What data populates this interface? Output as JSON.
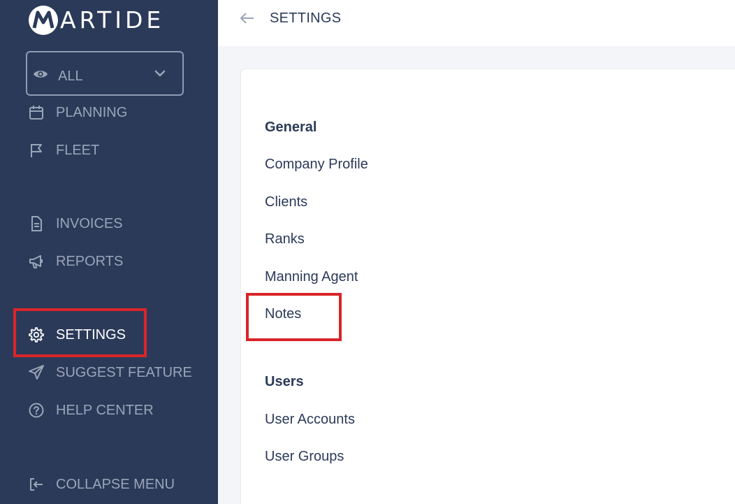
{
  "brand": {
    "name": "ARTIDE",
    "logo_letter": "M",
    "colors": {
      "sidebar_bg": "#2b3a59",
      "highlight": "#d9252a",
      "text_dark": "#2b3a59",
      "text_muted": "#9aa5b8"
    }
  },
  "view_select": {
    "selected": "ALL",
    "icon": "eye-icon"
  },
  "sidebar": {
    "items": [
      {
        "label": "PLANNING",
        "icon": "calendar-icon"
      },
      {
        "label": "FLEET",
        "icon": "flag-icon"
      },
      {
        "label": "INVOICES",
        "icon": "document-icon"
      },
      {
        "label": "REPORTS",
        "icon": "megaphone-icon"
      },
      {
        "label": "SETTINGS",
        "icon": "gear-icon",
        "active": true
      },
      {
        "label": "SUGGEST FEATURE",
        "icon": "send-icon"
      },
      {
        "label": "HELP CENTER",
        "icon": "question-icon"
      },
      {
        "label": "COLLAPSE MENU",
        "icon": "collapse-icon"
      }
    ]
  },
  "header": {
    "title": "SETTINGS",
    "back_icon": "arrow-left-icon"
  },
  "settings": {
    "general": {
      "heading": "General",
      "links": [
        "Company Profile",
        "Clients",
        "Ranks",
        "Manning Agent",
        "Notes"
      ]
    },
    "users": {
      "heading": "Users",
      "links": [
        "User Accounts",
        "User Groups"
      ]
    }
  }
}
